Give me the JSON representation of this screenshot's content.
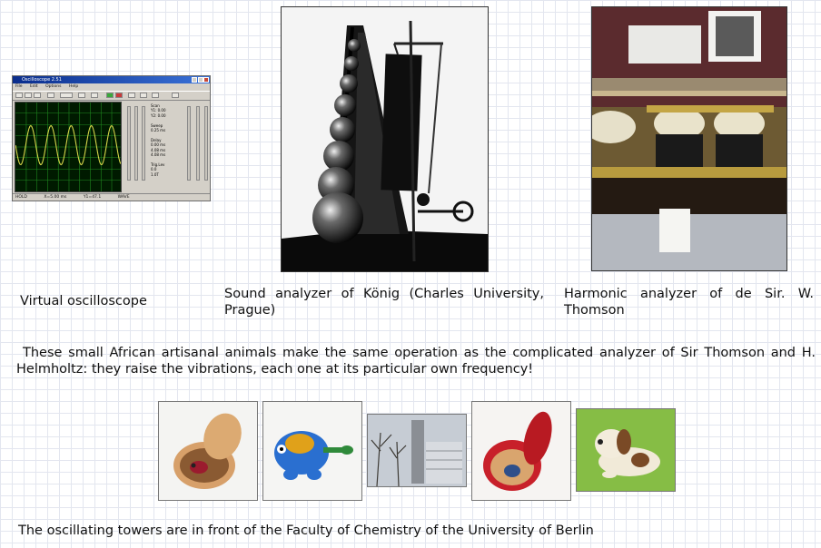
{
  "oscilloscope": {
    "window_title": "Oscilloscope 2.51",
    "menu": [
      "File",
      "Edit",
      "Options",
      "Help"
    ],
    "readout_lines": [
      "Scan",
      "Y1: 0.00",
      "Y2: 0.00",
      "",
      "Sweep",
      "0.25 ms",
      "",
      "Delay",
      "0.00 ms",
      "4.08 ms",
      "4.08 ms",
      "",
      "Trig.Lev",
      "0.0",
      "1.0T"
    ],
    "status": [
      "HOLD",
      "X=5.00 ms",
      "Y1=47.1",
      "WAVE"
    ]
  },
  "captions": {
    "oscilloscope": "Virtual oscilloscope",
    "konig": "Sound analyzer of König (Charles University, Prague)",
    "thomson": "Harmonic analyzer of de Sir. W. Thomson",
    "african_animals": "These small African artisanal animals make the same operation as the complicated analyzer of Sir Thomson and H. Helmholtz: they raise the vibrations, each one at its particular own frequency!",
    "towers": "The oscillating towers are in front of the Faculty of Chemistry of the University of Berlin"
  },
  "colors": {
    "grid_line": "#e3e6ef",
    "osc_trace": "#d8d84a",
    "osc_screen": "#001a00",
    "osc_grid": "#1f8a1f"
  }
}
